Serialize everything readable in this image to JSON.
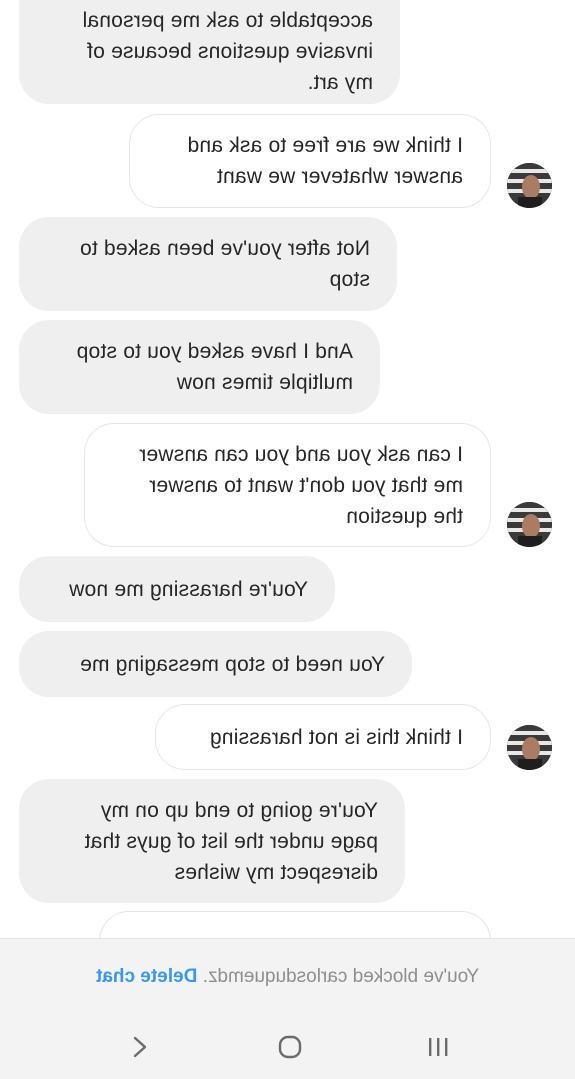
{
  "messages": [
    {
      "direction": "in",
      "text": "acceptable to ask me personal\ninvasive questions because of\nmy art."
    },
    {
      "direction": "out",
      "text": "I think we are free to ask and\nanswer whatever we want"
    },
    {
      "direction": "in",
      "text": "Not after you've been asked to\nstop"
    },
    {
      "direction": "in",
      "text": "And I have asked you to stop\nmultiple times now"
    },
    {
      "direction": "out",
      "text": "I can ask you and you can answer\nme that you don't want to answer\nthe question"
    },
    {
      "direction": "in",
      "text": "You're harassing me now"
    },
    {
      "direction": "in",
      "text": "You need to stop messaging me"
    },
    {
      "direction": "out",
      "text": "I think this is not harassing"
    },
    {
      "direction": "in",
      "text": "You're going to end up on my\npage under the list of guys that\ndisrespect my wishes"
    }
  ],
  "footer": {
    "blocked_text": "You've blocked carlosduquemdz.",
    "delete_label": "Delete chat"
  },
  "nav": {
    "back_icon": "chevron-back-icon",
    "home_icon": "home-circle-icon",
    "recents_icon": "recents-bars-icon"
  },
  "colors": {
    "incoming_bubble": "#efefef",
    "outgoing_border": "#e6e6e6",
    "link": "#3897f0"
  }
}
